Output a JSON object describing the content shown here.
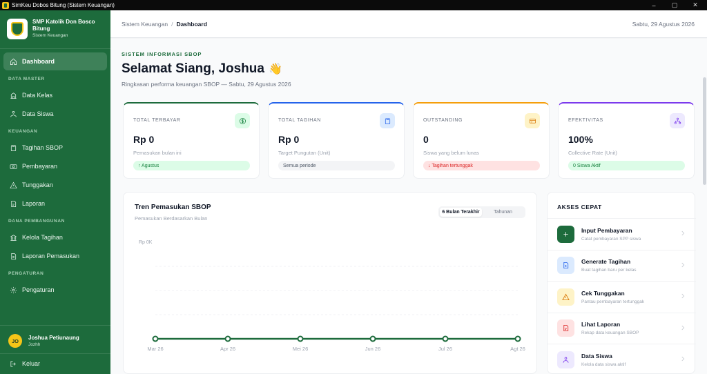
{
  "window": {
    "title": "SimKeu Dobos Bitung (Sistem Keuangan)",
    "controls": [
      "–",
      "▢",
      "✕"
    ]
  },
  "sidebar": {
    "school_name": "SMP Katolik Don Bosco Bitung",
    "app_subtitle": "Sistem Keuangan",
    "sections": {
      "master": "DATA MASTER",
      "keuangan": "KEUANGAN",
      "pembangunan": "DANA PEMBANGUNAN",
      "pengaturan": "PENGATURAN"
    },
    "items": {
      "dashboard": "Dashboard",
      "data_kelas": "Data Kelas",
      "data_siswa": "Data Siswa",
      "tagihan_sbop": "Tagihan SBOP",
      "pembayaran": "Pembayaran",
      "tunggakan": "Tunggakan",
      "laporan": "Laporan",
      "kelola_tagihan": "Kelola Tagihan",
      "laporan_pemasukan": "Laporan Pemasukan",
      "pengaturan": "Pengaturan"
    },
    "user": {
      "initials": "JO",
      "name": "Joshua Petiunaung",
      "username": "Jozhh"
    },
    "logout": "Keluar"
  },
  "header": {
    "breadcrumb_root": "Sistem Keuangan",
    "breadcrumb_sep": "/",
    "breadcrumb_current": "Dashboard",
    "date": "Sabtu, 29 Agustus 2026"
  },
  "hero": {
    "kicker": "SISTEM INFORMASI SBOP",
    "greeting": "Selamat Siang, Joshua",
    "wave_emoji": "👋",
    "subtitle": "Ringkasan performa keuangan SBOP — Sabtu, 29 Agustus 2026"
  },
  "stats": [
    {
      "label": "TOTAL TERBAYAR",
      "value": "Rp 0",
      "desc": "Pemasukan bulan ini",
      "pill": "↑ Agustus",
      "icon": "dollar-icon",
      "accent": "#1d6b3c",
      "icon_bg": "#dcfce7",
      "icon_color": "#15803d",
      "pill_bg": "#dcfce7",
      "pill_color": "#15803d"
    },
    {
      "label": "TOTAL TAGIHAN",
      "value": "Rp 0",
      "desc": "Target Pungutan (Unit)",
      "pill": "Semua periode",
      "icon": "clipboard-icon",
      "accent": "#2563eb",
      "icon_bg": "#dbeafe",
      "icon_color": "#2563eb",
      "pill_bg": "#f3f4f6",
      "pill_color": "#4b5563"
    },
    {
      "label": "OUTSTANDING",
      "value": "0",
      "desc": "Siswa yang belum lunas",
      "pill": "↓ Tagihan tertunggak",
      "icon": "card-icon",
      "accent": "#f59e0b",
      "icon_bg": "#fef3c7",
      "icon_color": "#d97706",
      "pill_bg": "#fee2e2",
      "pill_color": "#dc2626"
    },
    {
      "label": "EFEKTIVITAS",
      "value": "100%",
      "desc": "Collective Rate (Unit)",
      "pill": "0 Siswa Aktif",
      "icon": "network-icon",
      "accent": "#7c3aed",
      "icon_bg": "#ede9fe",
      "icon_color": "#7c3aed",
      "pill_bg": "#dcfce7",
      "pill_color": "#15803d"
    }
  ],
  "chart": {
    "title": "Tren Pemasukan SBOP",
    "subtitle": "Pemasukan Berdasarkan Bulan",
    "tabs": [
      "6 Bulan Terakhir",
      "Tahunan"
    ],
    "active_tab": 0,
    "line_color": "#1d6b3c"
  },
  "chart_data": {
    "type": "line",
    "categories": [
      "Mar 26",
      "Apr 26",
      "Mei 26",
      "Jun 26",
      "Jul 26",
      "Agt 26"
    ],
    "series": [
      {
        "values": [
          0,
          0,
          0,
          0,
          0,
          0
        ]
      }
    ],
    "y_tick_labels": [
      "Rp 0K"
    ],
    "ylim": [
      0,
      1
    ],
    "grid": true
  },
  "quick": {
    "title": "AKSES CEPAT",
    "items": [
      {
        "name": "Input Pembayaran",
        "sub": "Catat pembayaran SPP siswa",
        "icon": "plus-icon",
        "bg": "#1d6b3c",
        "color": "#ffffff"
      },
      {
        "name": "Generate Tagihan",
        "sub": "Buat tagihan baru per kelas",
        "icon": "file-plus-icon",
        "bg": "#dbeafe",
        "color": "#2563eb"
      },
      {
        "name": "Cek Tunggakan",
        "sub": "Pantau pembayaran tertunggak",
        "icon": "warning-icon",
        "bg": "#fef3c7",
        "color": "#d97706"
      },
      {
        "name": "Lihat Laporan",
        "sub": "Rekap data keuangan SBOP",
        "icon": "report-icon",
        "bg": "#fee2e2",
        "color": "#dc2626"
      },
      {
        "name": "Data Siswa",
        "sub": "Kelola data siswa aktif",
        "icon": "students-icon",
        "bg": "#ede9fe",
        "color": "#7c3aed"
      }
    ]
  }
}
